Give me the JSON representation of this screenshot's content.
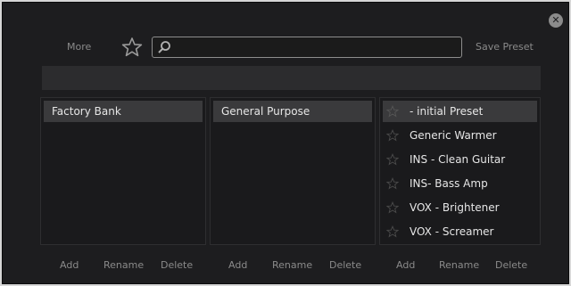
{
  "toolbar": {
    "more_label": "More",
    "search_value": "",
    "save_preset_label": "Save Preset"
  },
  "banks": {
    "items": [
      {
        "label": "Factory Bank",
        "selected": true
      }
    ],
    "footer": {
      "add": "Add",
      "rename": "Rename",
      "delete": "Delete"
    }
  },
  "categories": {
    "items": [
      {
        "label": "General Purpose",
        "selected": true
      }
    ],
    "footer": {
      "add": "Add",
      "rename": "Rename",
      "delete": "Delete"
    }
  },
  "presets": {
    "items": [
      {
        "label": "- initial Preset",
        "selected": true,
        "favorite": false
      },
      {
        "label": "Generic Warmer",
        "selected": false,
        "favorite": false
      },
      {
        "label": "INS - Clean Guitar",
        "selected": false,
        "favorite": false
      },
      {
        "label": "INS- Bass Amp",
        "selected": false,
        "favorite": false
      },
      {
        "label": "VOX - Brightener",
        "selected": false,
        "favorite": false
      },
      {
        "label": "VOX - Screamer",
        "selected": false,
        "favorite": false
      }
    ],
    "footer": {
      "add": "Add",
      "rename": "Rename",
      "delete": "Delete"
    }
  },
  "colors": {
    "background": "#1d1d1f",
    "panel": "#1a1a1c",
    "selected_row": "#3a3a3c",
    "muted_text": "#8a8a8a"
  }
}
